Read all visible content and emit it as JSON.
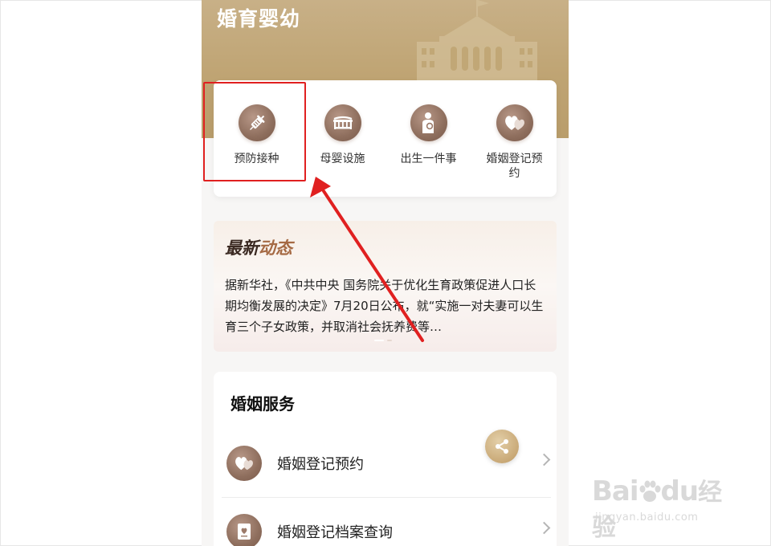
{
  "banner": {
    "title": "婚育婴幼"
  },
  "quick_services": [
    {
      "label": "预防接种",
      "icon": "vaccine-syringe-icon"
    },
    {
      "label": "母婴设施",
      "icon": "crib-icon"
    },
    {
      "label": "出生一件事",
      "icon": "mother-baby-icon"
    },
    {
      "label": "婚姻登记预约",
      "icon": "double-heart-icon"
    }
  ],
  "news": {
    "title_part1": "最新",
    "title_part2": "动态",
    "text": "据新华社，《中共中央 国务院关于优化生育政策促进人口长期均衡发展的决定》7月20日公布，就“实施一对夫妻可以生育三个子女政策，并取消社会抚养费等…",
    "pager": {
      "pages": 2,
      "active": 1
    }
  },
  "marriage_service": {
    "title": "婚姻服务",
    "items": [
      {
        "label": "婚姻登记预约",
        "icon": "double-heart-icon"
      },
      {
        "label": "婚姻登记档案查询",
        "icon": "certificate-book-icon"
      }
    ]
  },
  "colors": {
    "accent_gold": "#bfa473",
    "icon_brown": "#8e6e5d",
    "annotation_red": "#e02020"
  },
  "watermark": {
    "brand_prefix": "Bai",
    "brand_suffix": "du",
    "brand_cn": "经验",
    "url": "jingyan.baidu.com"
  }
}
